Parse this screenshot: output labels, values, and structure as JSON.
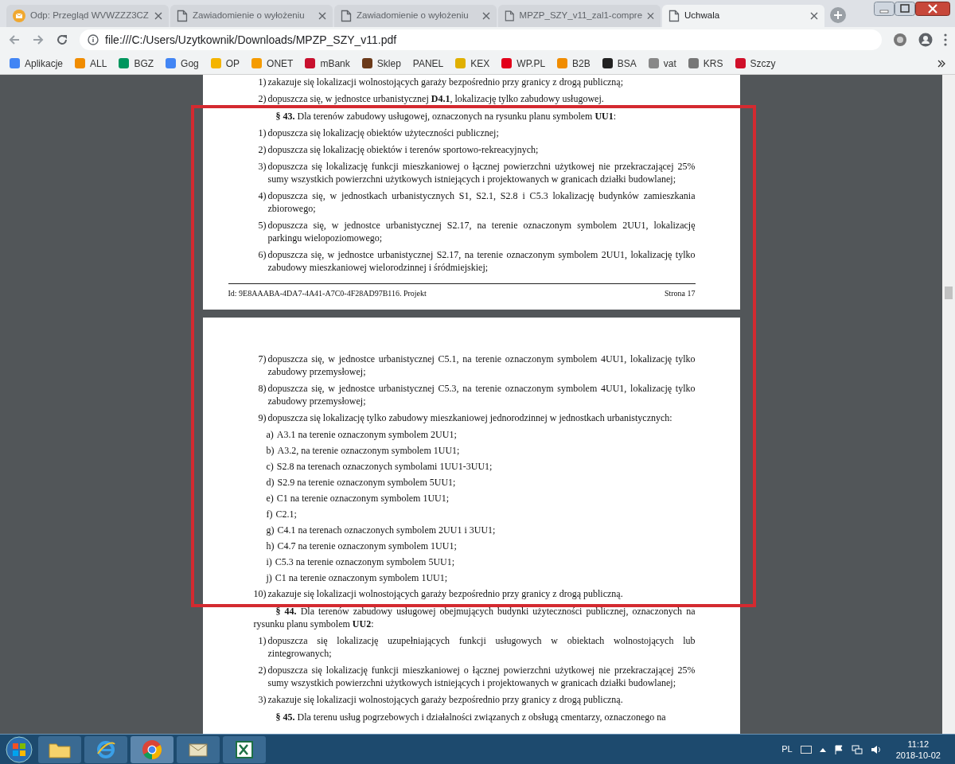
{
  "tabs": [
    {
      "title": "Odp: Przegląd WVWZZZ3CZ",
      "selected": false
    },
    {
      "title": "Zawiadomienie o wyłożeniu",
      "selected": false
    },
    {
      "title": "Zawiadomienie o wyłożeniu",
      "selected": false
    },
    {
      "title": "MPZP_SZY_v11_zal1-compre",
      "selected": false
    },
    {
      "title": "Uchwala",
      "selected": true
    }
  ],
  "address": "file:///C:/Users/Uzytkownik/Downloads/MPZP_SZY_v11.pdf",
  "bookmarks": [
    {
      "label": "Aplikacje",
      "color": "#4285f4"
    },
    {
      "label": "ALL",
      "color": "#f08c00"
    },
    {
      "label": "BGZ",
      "color": "#00965e"
    },
    {
      "label": "Gog",
      "color": "#4285f4"
    },
    {
      "label": "OP",
      "color": "#f4b400"
    },
    {
      "label": "ONET",
      "color": "#f59b00"
    },
    {
      "label": "mBank",
      "color": "#c8102e"
    },
    {
      "label": "Sklep",
      "color": "#6b3a1a"
    },
    {
      "label": "PANEL"
    },
    {
      "label": "KEX",
      "color": "#e0b000"
    },
    {
      "label": "WP.PL",
      "color": "#e2001a"
    },
    {
      "label": "B2B",
      "color": "#f08c00"
    },
    {
      "label": "BSA",
      "color": "#222222"
    },
    {
      "label": "vat",
      "color": "#888888"
    },
    {
      "label": "KRS",
      "color": "#777777"
    },
    {
      "label": "Szczy",
      "color": "#d0102a"
    }
  ],
  "pages": [
    {
      "blocks": [
        {
          "kind": "item",
          "num": "1)",
          "text": "zakazuje się lokalizacji wolnostojących garaży bezpośrednio przy granicy z drogą publiczną;"
        },
        {
          "kind": "item",
          "num": "2)",
          "text": "dopuszcza się, w jednostce urbanistycznej **D4.1**, lokalizację tylko zabudowy usługowej."
        },
        {
          "kind": "section",
          "text": "**§ 43.** Dla terenów zabudowy usługowej, oznaczonych na rysunku planu symbolem **UU1**:"
        },
        {
          "kind": "item",
          "num": "1)",
          "text": "dopuszcza się lokalizację obiektów użyteczności publicznej;"
        },
        {
          "kind": "item",
          "num": "2)",
          "text": "dopuszcza się lokalizację obiektów i terenów sportowo-rekreacyjnych;"
        },
        {
          "kind": "item",
          "num": "3)",
          "text": "dopuszcza się lokalizację funkcji mieszkaniowej o łącznej powierzchni użytkowej nie przekraczającej 25% sumy wszystkich powierzchni użytkowych istniejących i projektowanych w granicach działki budowlanej;"
        },
        {
          "kind": "item",
          "num": "4)",
          "text": "dopuszcza się, w jednostkach urbanistycznych S1, S2.1, S2.8 i C5.3 lokalizację budynków zamieszkania zbiorowego;"
        },
        {
          "kind": "item",
          "num": "5)",
          "text": "dopuszcza się, w jednostce urbanistycznej S2.17, na terenie oznaczonym symbolem 2UU1, lokalizację parkingu wielopoziomowego;"
        },
        {
          "kind": "item",
          "num": "6)",
          "text": "dopuszcza się, w jednostce urbanistycznej S2.17, na terenie oznaczonym symbolem 2UU1, lokalizację tylko zabudowy mieszkaniowej wielorodzinnej i śródmiejskiej;"
        }
      ],
      "footer_id": "Id: 9E8AAABA-4DA7-4A41-A7C0-4F28AD97B116. Projekt",
      "footer_page": "Strona 17"
    },
    {
      "blocks": [
        {
          "kind": "item",
          "num": "7)",
          "text": "dopuszcza się, w jednostce urbanistycznej C5.1, na terenie oznaczonym symbolem 4UU1, lokalizację tylko zabudowy przemysłowej;"
        },
        {
          "kind": "item",
          "num": "8)",
          "text": "dopuszcza się, w jednostce urbanistycznej C5.3, na terenie oznaczonym symbolem 4UU1, lokalizację tylko zabudowy przemysłowej;"
        },
        {
          "kind": "item",
          "num": "9)",
          "text": "dopuszcza się lokalizację tylko zabudowy mieszkaniowej jednorodzinnej w jednostkach urbanistycznych:"
        },
        {
          "kind": "sub",
          "num": "a)",
          "text": "A3.1 na terenie oznaczonym symbolem 2UU1;"
        },
        {
          "kind": "sub",
          "num": "b)",
          "text": "A3.2, na terenie oznaczonym symbolem 1UU1;"
        },
        {
          "kind": "sub",
          "num": "c)",
          "text": "S2.8 na terenach oznaczonych symbolami 1UU1-3UU1;"
        },
        {
          "kind": "sub",
          "num": "d)",
          "text": "S2.9 na terenie oznaczonym symbolem 5UU1;"
        },
        {
          "kind": "sub",
          "num": "e)",
          "text": "C1 na terenie oznaczonym symbolem 1UU1;"
        },
        {
          "kind": "sub",
          "num": "f)",
          "text": "C2.1;"
        },
        {
          "kind": "sub",
          "num": "g)",
          "text": "C4.1 na terenach oznaczonych symbolem 2UU1 i 3UU1;"
        },
        {
          "kind": "sub",
          "num": "h)",
          "text": "C4.7 na terenie oznaczonym symbolem 1UU1;"
        },
        {
          "kind": "sub",
          "num": "i)",
          "text": "C5.3 na terenie oznaczonym symbolem 5UU1;"
        },
        {
          "kind": "sub",
          "num": "j)",
          "text": "C1 na terenie oznaczonym symbolem 1UU1;"
        },
        {
          "kind": "item",
          "num": "10)",
          "text": "zakazuje się lokalizacji wolnostojących garaży bezpośrednio przy granicy z drogą publiczną."
        },
        {
          "kind": "section",
          "text": "**§ 44.** Dla terenów zabudowy usługowej obejmujących budynki użyteczności publicznej, oznaczonych na rysunku planu symbolem **UU2**:"
        },
        {
          "kind": "item",
          "num": "1)",
          "text": "dopuszcza się lokalizację uzupełniających funkcji usługowych w obiektach wolnostojących lub zintegrowanych;"
        },
        {
          "kind": "item",
          "num": "2)",
          "text": "dopuszcza się lokalizację funkcji mieszkaniowej o łącznej powierzchni użytkowej nie przekraczającej 25% sumy wszystkich powierzchni użytkowych istniejących i projektowanych w granicach działki budowlanej;"
        },
        {
          "kind": "item",
          "num": "3)",
          "text": "zakazuje się lokalizacji wolnostojących garaży bezpośrednio przy granicy z drogą publiczną."
        },
        {
          "kind": "section",
          "text": "**§ 45.** Dla terenu usług pogrzebowych i działalności związanych z obsługą cmentarzy, oznaczonego na"
        }
      ]
    }
  ],
  "tray": {
    "language": "PL",
    "time": "11:12",
    "date": "2018-10-02"
  }
}
